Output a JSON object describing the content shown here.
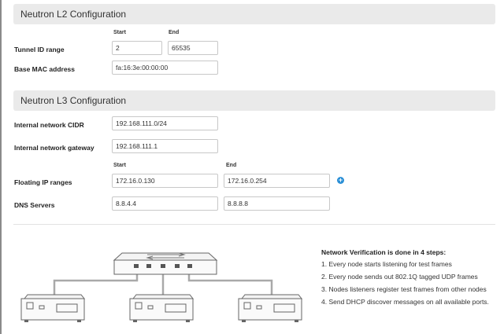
{
  "l2": {
    "title": "Neutron L2 Configuration",
    "col_start": "Start",
    "col_end": "End",
    "tunnel_label": "Tunnel ID range",
    "tunnel_start": "2",
    "tunnel_end": "65535",
    "mac_label": "Base MAC address",
    "mac_value": "fa:16:3e:00:00:00"
  },
  "l3": {
    "title": "Neutron L3 Configuration",
    "cidr_label": "Internal network CIDR",
    "cidr_value": "192.168.111.0/24",
    "gateway_label": "Internal network gateway",
    "gateway_value": "192.168.111.1",
    "col_start": "Start",
    "col_end": "End",
    "floating_label": "Floating IP ranges",
    "floating_start": "172.16.0.130",
    "floating_end": "172.16.0.254",
    "add_symbol": "+",
    "dns_label": "DNS Servers",
    "dns_1": "8.8.4.4",
    "dns_2": "8.8.8.8"
  },
  "verification": {
    "title": "Network Verification is done in 4 steps:",
    "steps": [
      "1. Every node starts listening for test frames",
      "2. Every node sends out 802.1Q tagged UDP frames",
      "3. Nodes listeners register test frames from other nodes",
      "4. Send DHCP discover messages on all available ports."
    ]
  },
  "icons": {
    "add": "plus-circle-icon",
    "switch": "network-switch-icon",
    "server": "server-icon"
  },
  "colors": {
    "accent": "#2a8fd6",
    "header_bg": "#eaeaea"
  }
}
